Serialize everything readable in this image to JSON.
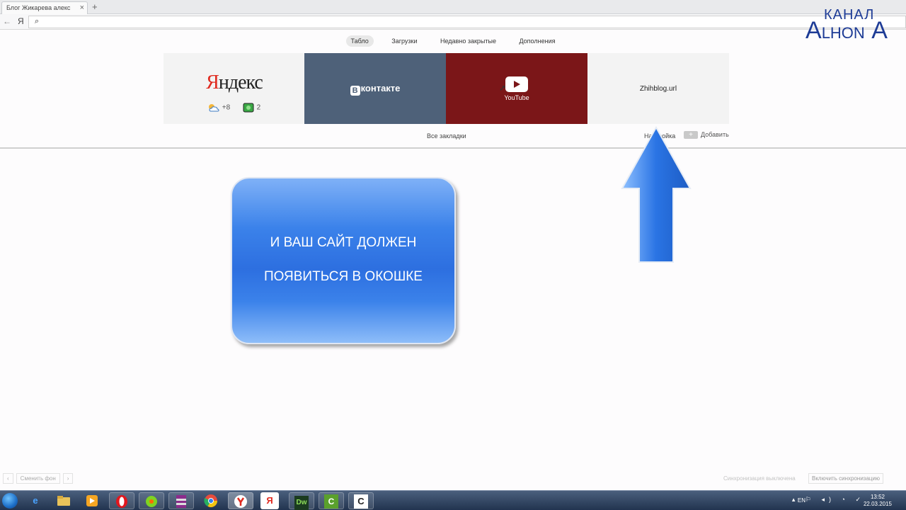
{
  "browser": {
    "tab_title": "Блог Жикарева алекс",
    "tab_close": "×",
    "tab_add": "+",
    "nav_back": "←",
    "nav_brand": "Я",
    "search_glyph": "⌕"
  },
  "watermark": {
    "line1": "КАНАЛ",
    "line2_big1": "A",
    "line2_small": "LHON",
    "line2_big2": "A"
  },
  "menu": {
    "items": [
      "Табло",
      "Загрузки",
      "Недавно закрытые",
      "Дополнения"
    ],
    "active": "Табло"
  },
  "tiles": {
    "yandex": {
      "logo_first": "Я",
      "logo_rest": "ндекс",
      "weather": "+8",
      "traffic": "2"
    },
    "vk": {
      "badge": "В",
      "name": "контакте"
    },
    "youtube": {
      "label": "YouTube"
    },
    "zhihblog": {
      "label": "Zhihblog.url"
    }
  },
  "bookmarks": {
    "all": "Все закладки",
    "settings": "Настройка",
    "add": "Добавить",
    "add_symbol": "+"
  },
  "callout": {
    "line1": "И ВАШ САЙТ ДОЛЖЕН",
    "line2": "ПОЯВИТЬСЯ В ОКОШКЕ"
  },
  "footer": {
    "prev": "‹",
    "change_bg": "Сменить фон",
    "next": "›",
    "sync_off": "Синхронизация выключена",
    "sync_on": "Включить синхронизацию"
  },
  "taskbar": {
    "icons": [
      "ie-icon",
      "explorer-icon",
      "media-player-icon",
      "opera-icon",
      "icq-icon",
      "winrar-icon",
      "chrome-icon",
      "yandex-browser-icon",
      "yandex-icon",
      "dreamweaver-icon",
      "camtasia-icon",
      "camtasia-recorder-icon"
    ],
    "lang": "EN",
    "time": "13:52",
    "date": "22.03.2015"
  },
  "colors": {
    "vk": "#4e6179",
    "youtube": "#7b1618",
    "callout": "#2d6fe0",
    "arrow": "#2a74e4",
    "watermark": "#1e3c96"
  }
}
